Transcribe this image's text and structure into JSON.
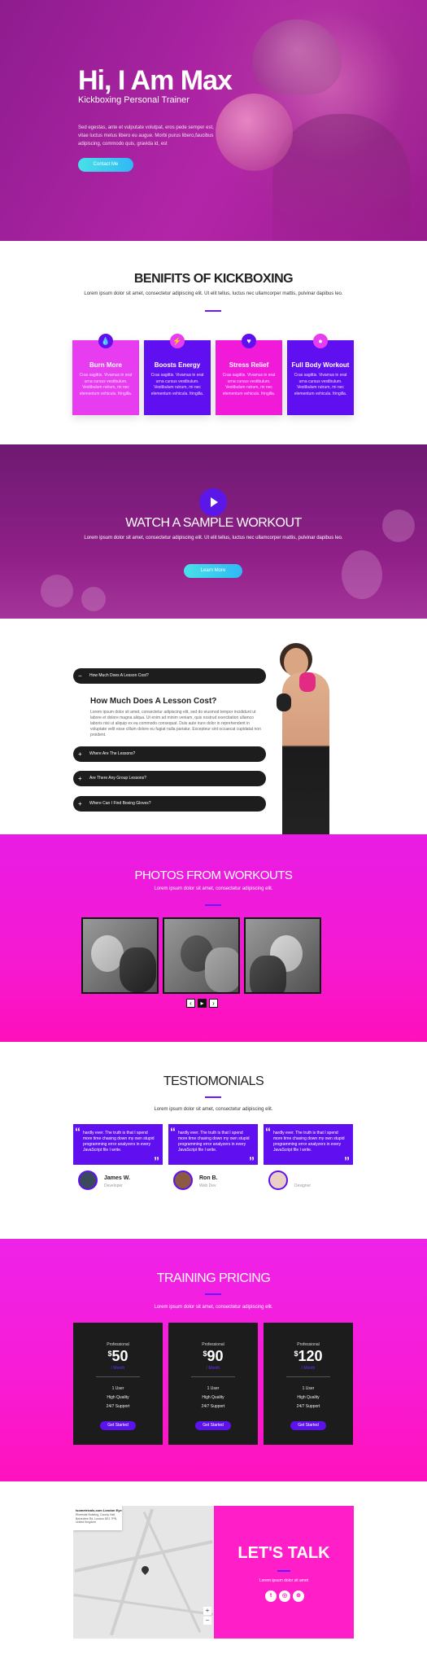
{
  "hero": {
    "title": "Hi, I Am Max",
    "subtitle": "Kickboxing Personal Trainer",
    "bio": "Sed egestas, ante et vulputate volutpat, eros pede semper est, vitae luctus metus libero eu augue. Morbi purus libero,faucibus adipiscing, commodo quis, gravida id, est",
    "cta": "Contact Me"
  },
  "benefits": {
    "title": "BENIFITS OF KICKBOXING",
    "subtitle": "Lorem ipsum dolor sit amet, consectetur adipiscing elit. Ut elit tellus, luctus nec ullamcorper mattis, pulvinar dapibus leo.",
    "cards": [
      {
        "title": "Burn More",
        "icon": "💧",
        "text": "Cras sagittis. Vivamus in erat urna cursus vestibulum. Vestibulum rutrum, mi nec elementum vehicula. fringilla."
      },
      {
        "title": "Boosts Energy",
        "icon": "⚡",
        "text": "Cras sagittis. Vivamus in erat urna cursus vestibulum. Vestibulum rutrum, mi nec elementum vehicula. fringilla."
      },
      {
        "title": "Stress Relief",
        "icon": "♥",
        "text": "Cras sagittis. Vivamus in erat urna cursus vestibulum. Vestibulum rutrum, mi nec elementum vehicula. fringilla."
      },
      {
        "title": "Full Body Workout",
        "icon": "●",
        "text": "Cras sagittis. Vivamus in erat urna cursus vestibulum. Vestibulum rutrum, mi nec elementum vehicula. fringilla."
      }
    ]
  },
  "video": {
    "title": "WATCH A SAMPLE WORKOUT",
    "subtitle": "Lorem ipsum dolor sit amet, consectetur adipiscing elit. Ut elit tellus, luctus nec ullamcorper mattis, pulvinar dapibus leo.",
    "cta": "Learn More"
  },
  "faq": {
    "items": [
      {
        "question": "How Much Does A Lesson Cost?",
        "open": true
      },
      {
        "question": "Where Are The Lessons?",
        "open": false
      },
      {
        "question": "Are There Any Group Lessons?",
        "open": false
      },
      {
        "question": "Where Can I Find Boxing Gloves?",
        "open": false
      }
    ],
    "answer_title": "How Much Does A Lesson Cost?",
    "answer_text": "Lorem ipsum dolor sit amet, consectetur adipiscing elit, sed do eiusmod tempor incididunt ut labore et dolore magna aliqua. Ut enim ad minim veniam, quis nostrud exercitation ullamco laboris nisi ut aliquip ex ea commodo consequat. Duis aute irure dolor in reprehenderit in voluptate velit esse cillum dolore eu fugiat nulla pariatur. Excepteur sint occaecat cupidatat non proident."
  },
  "photos": {
    "title": "PHOTOS FROM WORKOUTS",
    "subtitle": "Lorem ipsum dolor sit amet, consectetur adipiscing elit.",
    "prev": "‹",
    "pause": "▸",
    "next": "›"
  },
  "testimonials": {
    "title": "TESTIOMONIALS",
    "subtitle": "Lorem ipsum dolor sit amet, consectetur adipiscing elit.",
    "items": [
      {
        "quote": "hardly ever. The truth is that I spend more time chasing down my own stupid programming error analyzers in every JavaScript file I write.",
        "name": "James W.",
        "role": "Developer"
      },
      {
        "quote": "hardly ever. The truth is that I spend more time chasing down my own stupid programming error analyzers in every JavaScript file I write.",
        "name": "Ron B.",
        "role": "Web Dev"
      },
      {
        "quote": "hardly ever. The truth is that I spend more time chasing down my own stupid programming error analyzers in every JavaScript file I write.",
        "name": "",
        "role": "Designer"
      }
    ]
  },
  "pricing": {
    "title": "TRAINING PRICING",
    "subtitle": "Lorem ipsum dolor sit amet, consectetur adipiscing elit.",
    "plans": [
      {
        "label": "Professional",
        "currency": "$",
        "price": "50",
        "period": "/ Month",
        "features": [
          "1 User",
          "High Quality",
          "24/7 Support"
        ],
        "button": "Get Started"
      },
      {
        "label": "Professional",
        "currency": "$",
        "price": "90",
        "period": "/ Month",
        "features": [
          "1 User",
          "High Quality",
          "24/7 Support"
        ],
        "button": "Get Started"
      },
      {
        "label": "Professional",
        "currency": "$",
        "price": "120",
        "period": "/ Month",
        "features": [
          "1 User",
          "High Quality",
          "24/7 Support"
        ],
        "button": "Get Started"
      }
    ]
  },
  "contact": {
    "map_title": "Isometricals.com London Eye",
    "map_address": "Riverside Building, County Hall, Belvedere Rd, London SE1 7PB, United Kingdom",
    "title": "LET'S TALK",
    "subtitle": "Lorem ipsum dolor sit amet",
    "zoom_in": "+",
    "zoom_out": "−",
    "social": [
      {
        "icon": "twitter-icon",
        "glyph": "t"
      },
      {
        "icon": "instagram-icon",
        "glyph": "◎"
      },
      {
        "icon": "dribbble-icon",
        "glyph": "⊕"
      }
    ]
  },
  "colors": {
    "purple": "#6010f0",
    "magenta": "#ff1ec8",
    "pink_card": "#e81fd8",
    "cyan_button": "#49e0e8",
    "dark_card": "#1c1c1c"
  }
}
